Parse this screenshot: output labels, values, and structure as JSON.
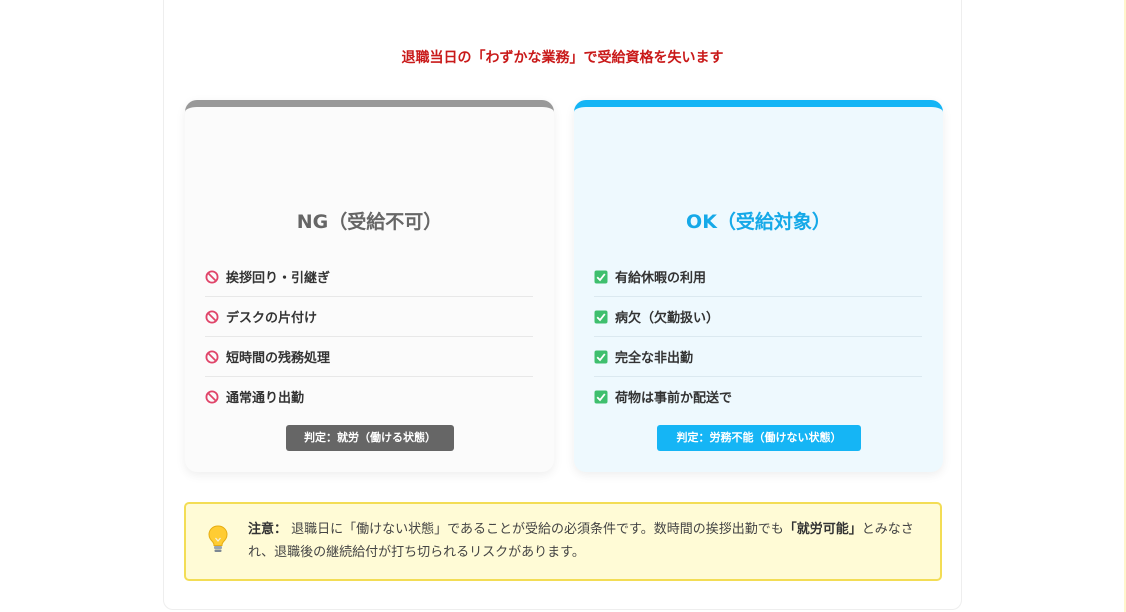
{
  "headline": "退職当日の「わずかな業務」で受給資格を失います",
  "ng_panel": {
    "title": "NG（受給不可）",
    "items": [
      "挨拶回り・引継ぎ",
      "デスクの片付け",
      "短時間の残務処理",
      "通常通り出勤"
    ],
    "item_icon": "prohibited-icon",
    "badge": "判定：就労（働ける状態）",
    "accent_color": "#999999"
  },
  "ok_panel": {
    "title": "OK（受給対象）",
    "items": [
      "有給休暇の利用",
      "病欠（欠勤扱い）",
      "完全な非出勤",
      "荷物は事前か配送で"
    ],
    "item_icon": "check-box-icon",
    "badge": "判定：労務不能（働けない状態）",
    "accent_color": "#15b5f5"
  },
  "note": {
    "icon": "lightbulb-icon",
    "label": "注意：",
    "text_1": "退職日に「働けない状態」であることが受給の必須条件です。数時間の挨拶出勤でも",
    "emphasis": "「就労可能」",
    "text_2": "とみなされ、退職後の継続給付が打ち切られるリスクがあります。"
  }
}
